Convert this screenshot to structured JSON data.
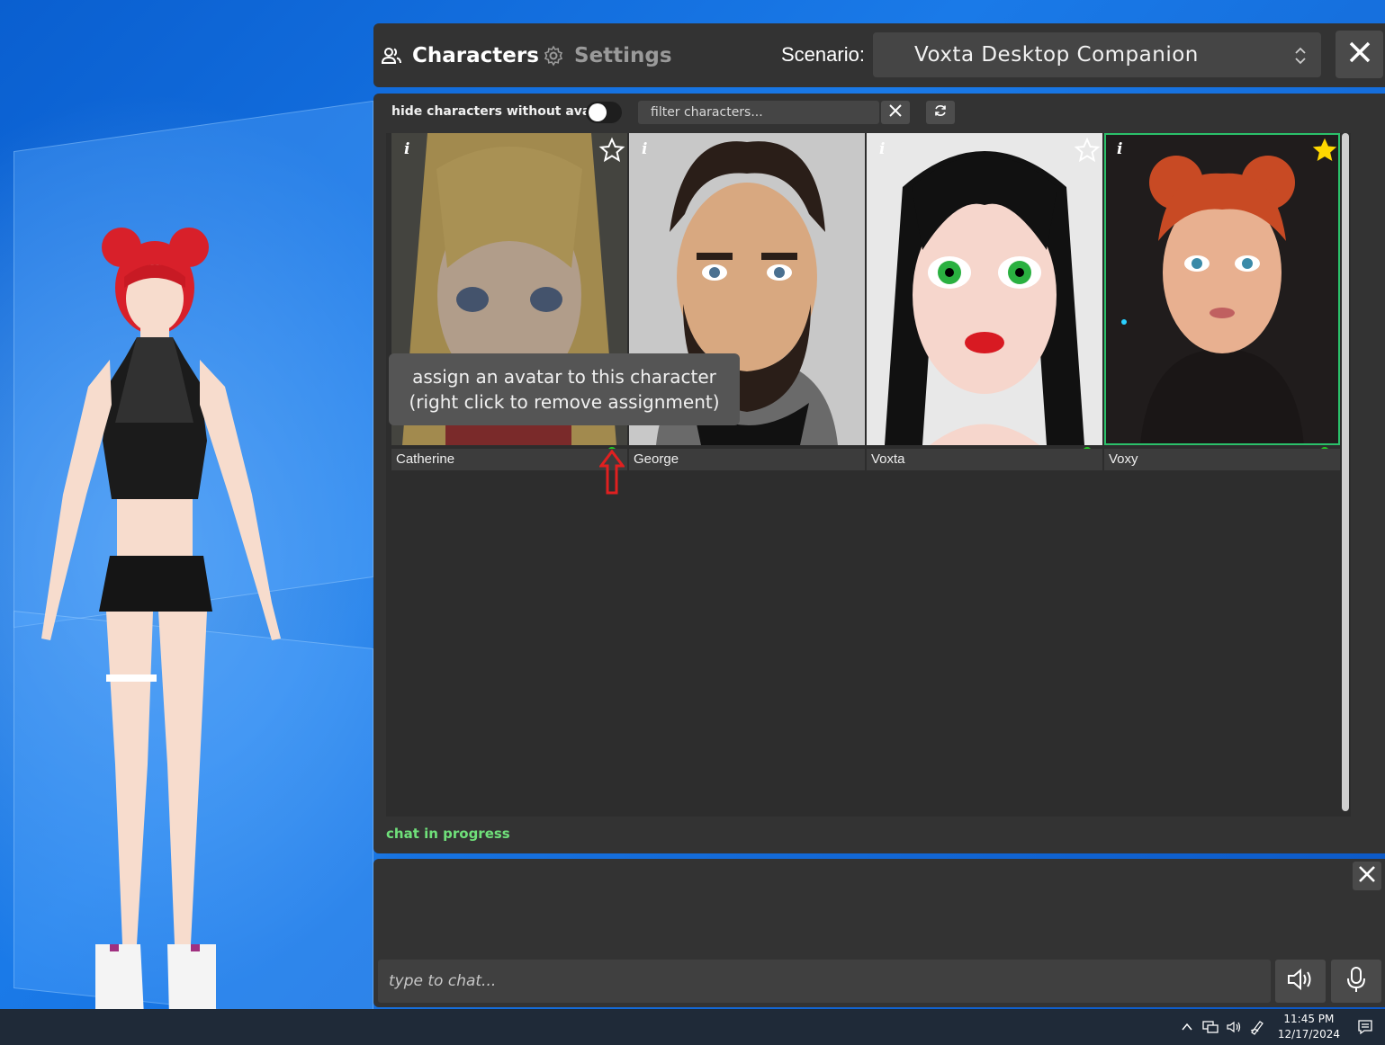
{
  "tabs": {
    "characters_label": "Characters",
    "settings_label": "Settings"
  },
  "scenario": {
    "label": "Scenario:",
    "value": "Voxta Desktop Companion"
  },
  "toolbar": {
    "hide_without_avatar_label": "hide characters without avatar",
    "hide_without_avatar_on": false,
    "filter_placeholder": "filter characters..."
  },
  "characters": [
    {
      "name": "Catherine",
      "info": "i",
      "favorite": false,
      "has_avatar": true,
      "selected": false
    },
    {
      "name": "George",
      "info": "i",
      "favorite": false,
      "has_avatar": false,
      "selected": false
    },
    {
      "name": "Voxta",
      "info": "i",
      "favorite": false,
      "has_avatar": true,
      "selected": false
    },
    {
      "name": "Voxy",
      "info": "i",
      "favorite": true,
      "has_avatar": true,
      "selected": true
    }
  ],
  "tooltip": {
    "line1": "assign an avatar to this character",
    "line2": "(right click to remove assignment)"
  },
  "status": "chat in progress",
  "chat": {
    "placeholder": "type to chat..."
  },
  "taskbar": {
    "time": "11:45 PM",
    "date": "12/17/2024"
  },
  "colors": {
    "panel": "#333333",
    "accent_green": "#2bc06a",
    "status_green": "#6fe07a",
    "favorite_star": "#ffd700",
    "assign_icon": "#22cc22",
    "arrow_red": "#e02020"
  }
}
